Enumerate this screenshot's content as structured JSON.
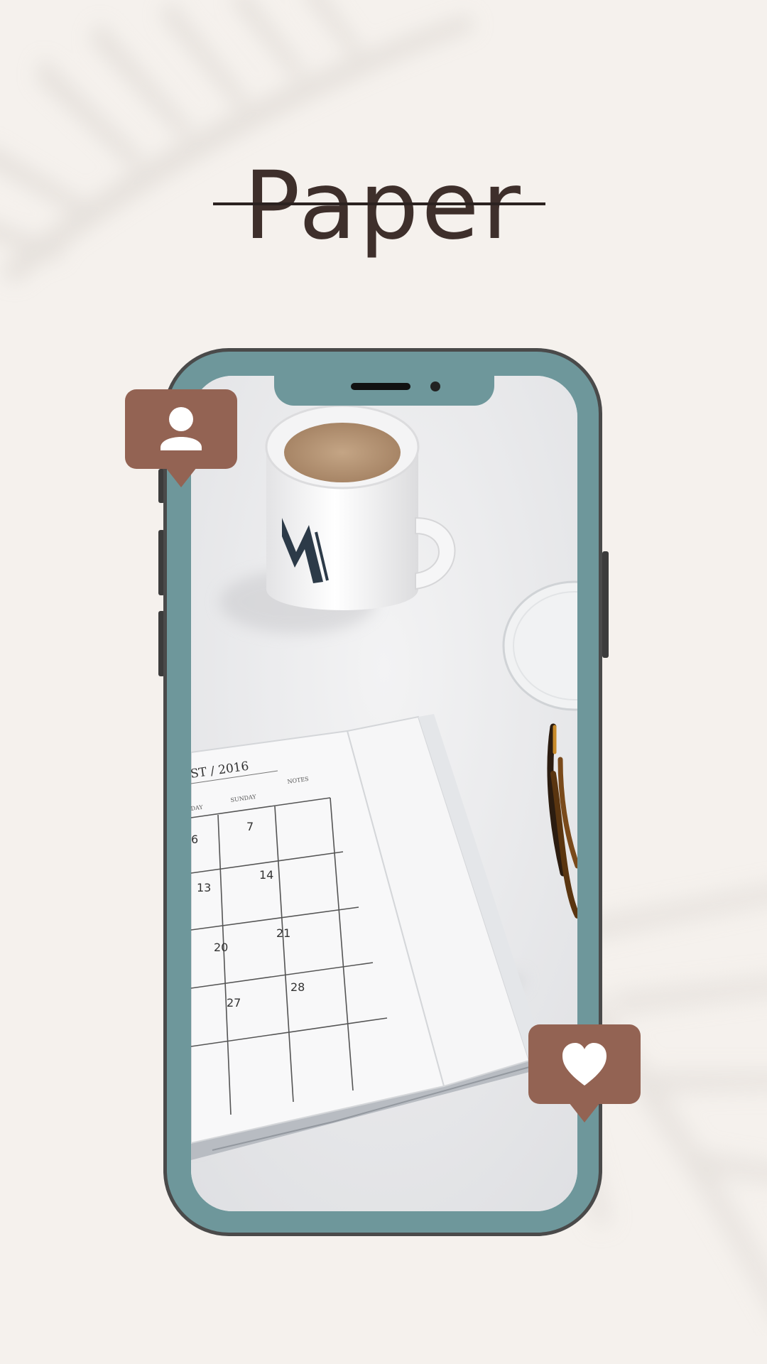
{
  "title": "Paper",
  "colors": {
    "background": "#f5f1ed",
    "phone_frame": "#6e979b",
    "bubble": "#936353",
    "title_text": "#3e2f2b"
  },
  "icons": {
    "profile": "user-icon",
    "like": "heart-icon"
  },
  "screen_photo": {
    "calendar_header": "ST   / 2016",
    "calendar_days": [
      "DAY",
      "SUNDAY",
      "NOTES"
    ],
    "calendar_dates": [
      "6",
      "7",
      "13",
      "14",
      "20",
      "21",
      "27",
      "28"
    ]
  }
}
